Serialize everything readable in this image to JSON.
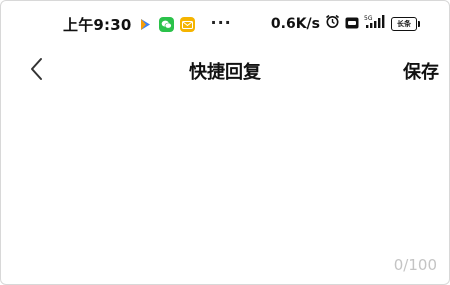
{
  "status_bar": {
    "time": "上午9:30",
    "more": "···",
    "net_speed": "0.6K/s",
    "battery_label": "长条",
    "icons": [
      "play-store-icon",
      "wechat-icon",
      "mail-icon",
      "alarm-icon",
      "hd-icon",
      "signal-icon",
      "battery-icon"
    ]
  },
  "nav": {
    "title": "快捷回复",
    "save_label": "保存",
    "back_icon": "chevron-left-icon"
  },
  "editor": {
    "value": "",
    "placeholder": "",
    "counter": "0/100"
  },
  "colors": {
    "text": "#111111",
    "counter": "#c4c4c4",
    "wechat": "#2bc24a",
    "mail": "#f5b400"
  }
}
